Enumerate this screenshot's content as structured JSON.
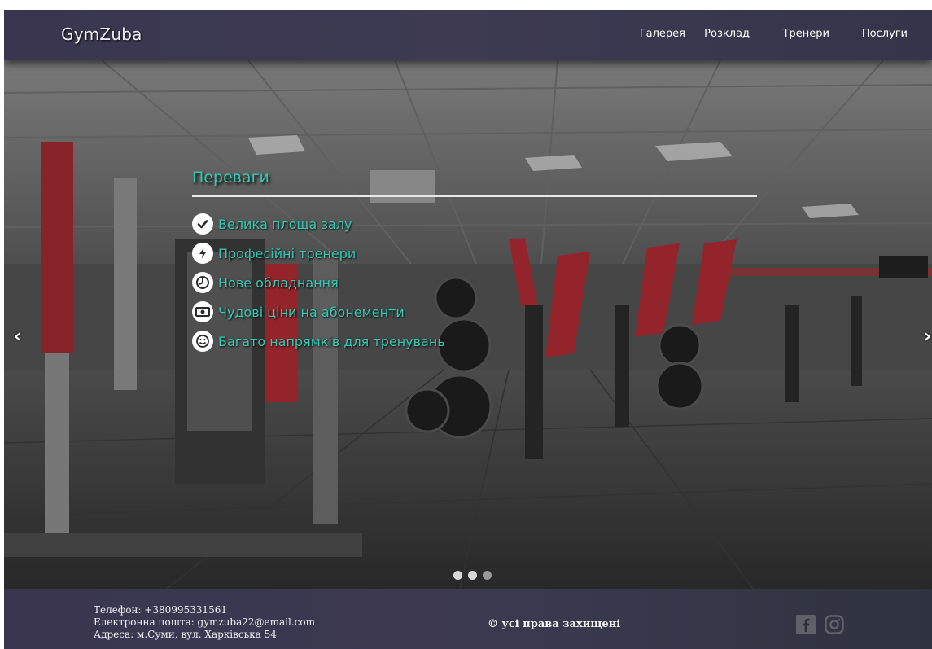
{
  "header": {
    "logo": "GymZuba",
    "nav": [
      "Галерея",
      "Розклад",
      "Тренери",
      "Послуги"
    ]
  },
  "hero": {
    "title": "Переваги",
    "items": [
      {
        "icon": "checkmark-icon",
        "label": "Велика площа залу"
      },
      {
        "icon": "lightning-icon",
        "label": "Професійні тренери"
      },
      {
        "icon": "clock-icon",
        "label": "Нове обладнання"
      },
      {
        "icon": "money-icon",
        "label": "Чудові ціни на абонементи"
      },
      {
        "icon": "smile-icon",
        "label": "Багато напрямків для тренувань"
      }
    ],
    "prev_arrow": "‹",
    "next_arrow": "›",
    "slides_count": 3,
    "active_slide": 1
  },
  "footer": {
    "phone": "Телефон: +380995331561",
    "email": "Електронна пошта: gymzuba22@email.com",
    "address": "Адреса: м.Суми, вул. Харківська 54",
    "rights": "© усі права захищені",
    "social": [
      "facebook-icon",
      "instagram-icon"
    ]
  },
  "colors": {
    "accent": "#35c9b3",
    "header_bg": "#3a3650",
    "footer_bg": "#3a3650"
  }
}
